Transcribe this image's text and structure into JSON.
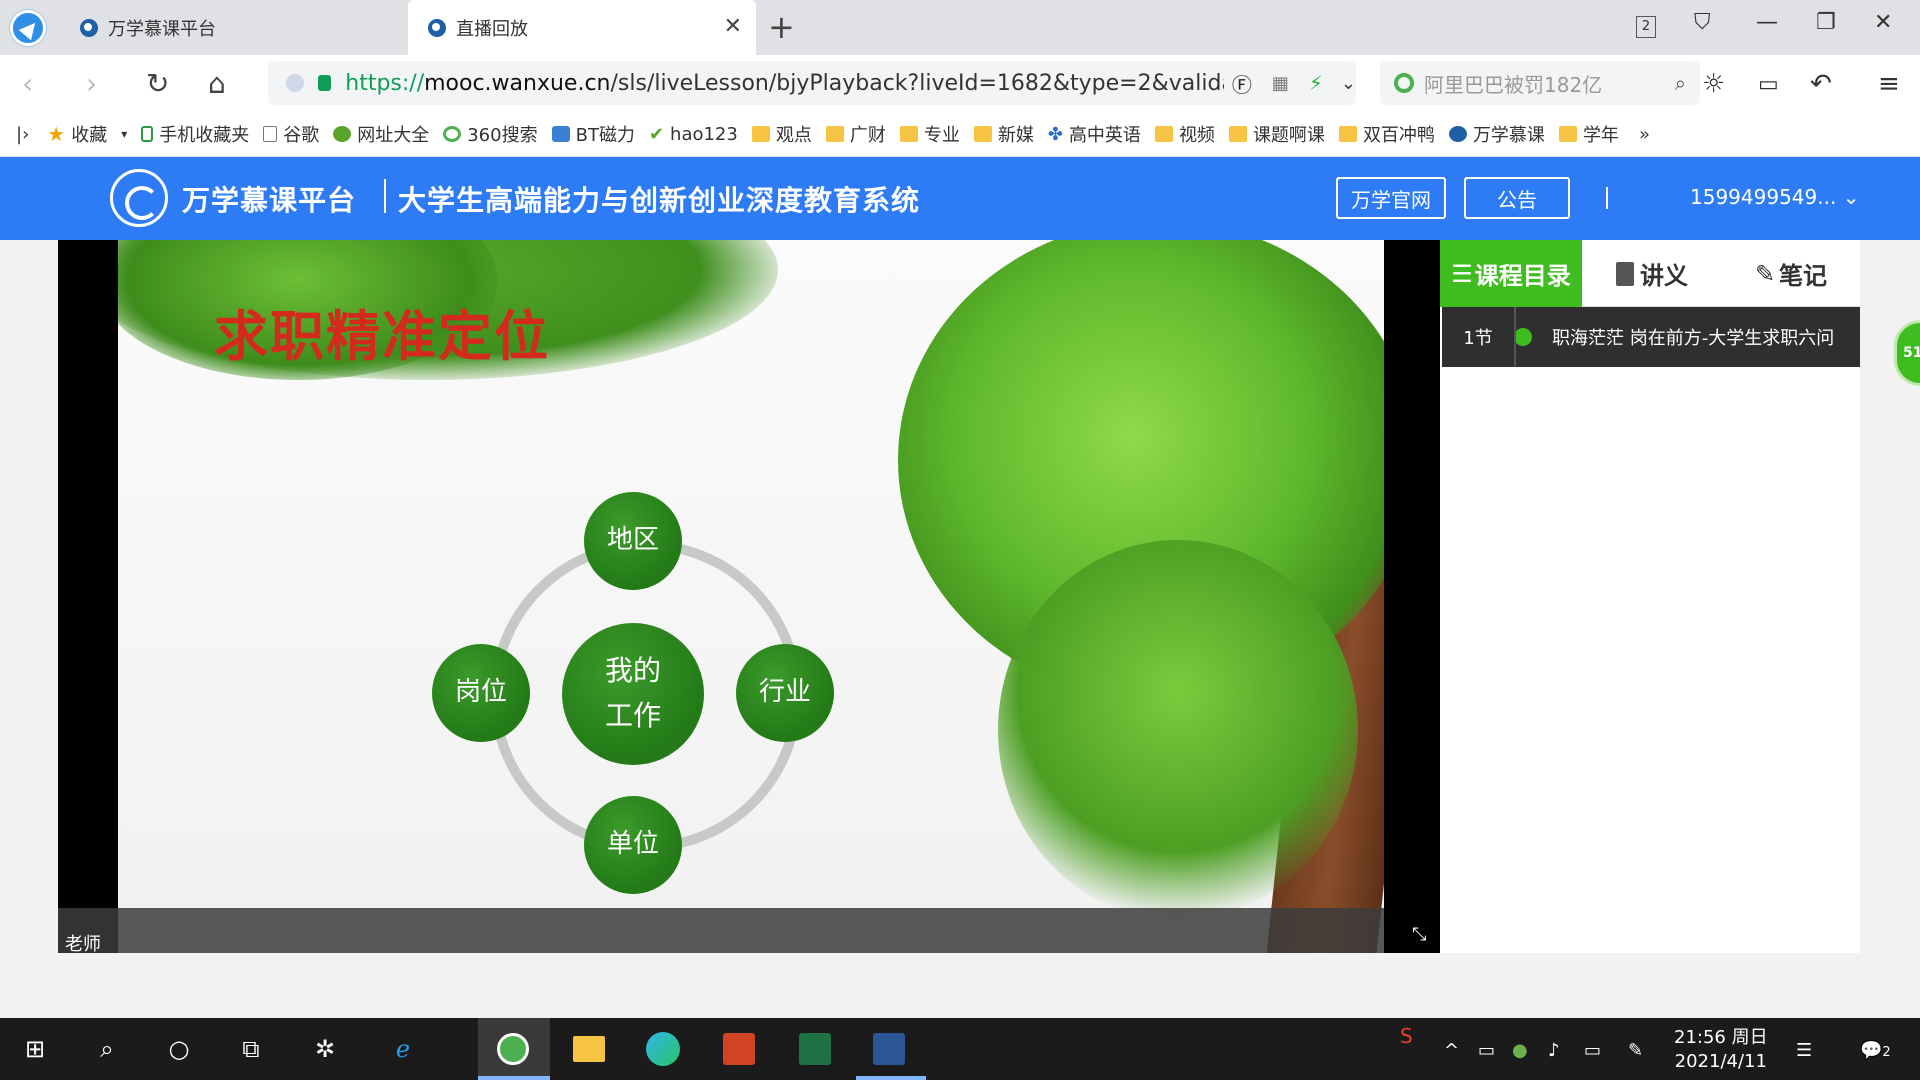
{
  "browser": {
    "tabs": [
      {
        "title": "万学慕课平台"
      },
      {
        "title": "直播回放"
      }
    ],
    "tab_count": "2",
    "url": {
      "protocol": "https://",
      "domain": "mooc.wanxue.cn",
      "path": "/sls/liveLesson/bjyPlayback?liveId=1682&type=2&validateT"
    },
    "search_placeholder": "阿里巴巴被罚182亿",
    "bookmarks": [
      {
        "label": "收藏",
        "icon": "star-icon"
      },
      {
        "label": "手机收藏夹",
        "icon": "phone-icon"
      },
      {
        "label": "谷歌",
        "icon": "page-icon"
      },
      {
        "label": "网址大全",
        "icon": "green-plus-icon"
      },
      {
        "label": "360搜索",
        "icon": "360-icon"
      },
      {
        "label": "BT磁力",
        "icon": "bt-icon"
      },
      {
        "label": "hao123",
        "icon": "hao123-icon"
      },
      {
        "label": "观点",
        "icon": "folder-icon"
      },
      {
        "label": "广财",
        "icon": "folder-icon"
      },
      {
        "label": "专业",
        "icon": "folder-icon"
      },
      {
        "label": "新媒",
        "icon": "folder-icon"
      },
      {
        "label": "高中英语",
        "icon": "paw-icon"
      },
      {
        "label": "视频",
        "icon": "folder-icon"
      },
      {
        "label": "课题啊课",
        "icon": "folder-icon"
      },
      {
        "label": "双百冲鸭",
        "icon": "folder-icon"
      },
      {
        "label": "万学慕课",
        "icon": "wanxue-icon"
      },
      {
        "label": "学年",
        "icon": "folder-icon"
      }
    ]
  },
  "site": {
    "title": "万学慕课平台",
    "subtitle": "大学生高端能力与创新创业深度教育系统",
    "official_button": "万学官网",
    "notice_button": "公告",
    "user": "1599499549..."
  },
  "player": {
    "slide_title": "求职精准定位",
    "center_node": "我的工作",
    "nodes": {
      "top": "地区",
      "left": "岗位",
      "right": "行业",
      "bottom": "单位"
    },
    "speaker_label": "老师"
  },
  "panel": {
    "tabs": [
      "课程目录",
      "讲义",
      "笔记"
    ],
    "lessons": [
      {
        "num": "1节",
        "title": "职海茫茫 岗在前方-大学生求职六问"
      }
    ],
    "badge": "51"
  },
  "taskbar": {
    "time": "21:56 周日",
    "date": "2021/4/11",
    "notifications": "2"
  },
  "colors": {
    "header_blue": "#2d7cf5",
    "accent_green": "#3fbc1f",
    "node_green": "#237a17",
    "slide_title_red": "#d42a1e"
  }
}
